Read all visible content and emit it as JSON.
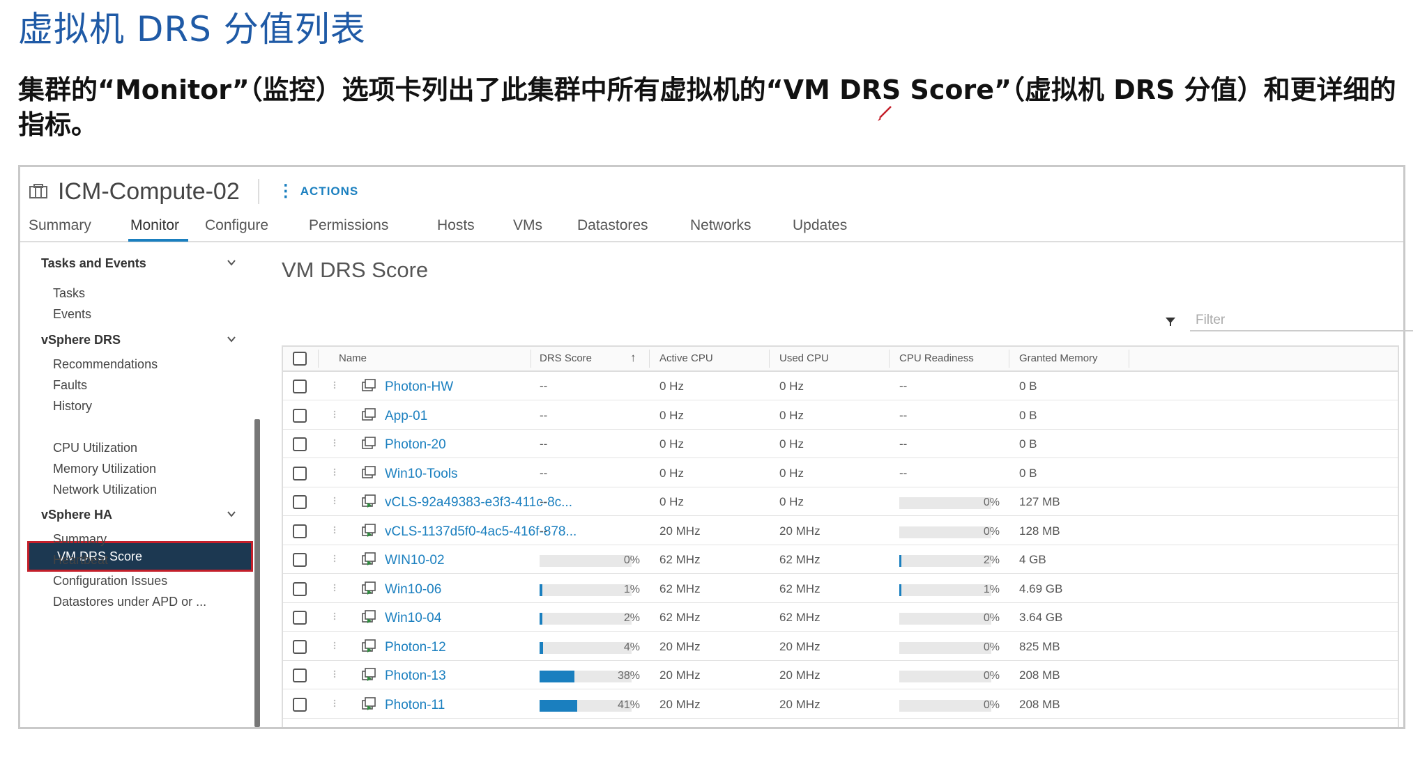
{
  "slide": {
    "title": "虚拟机 DRS 分值列表",
    "description": "集群的“Monitor”（监控）选项卡列出了此集群中所有虚拟机的“VM DRS Score”（虚拟机 DRS 分值）和更详细的指标。"
  },
  "header": {
    "object_name": "ICM-Compute-02",
    "actions_label": "ACTIONS",
    "icon": "cluster-icon"
  },
  "tabs": [
    {
      "label": "Summary"
    },
    {
      "label": "Monitor",
      "active": true
    },
    {
      "label": "Configure"
    },
    {
      "label": "Permissions"
    },
    {
      "label": "Hosts"
    },
    {
      "label": "VMs"
    },
    {
      "label": "Datastores"
    },
    {
      "label": "Networks"
    },
    {
      "label": "Updates"
    }
  ],
  "sidebar": {
    "sections": [
      {
        "label": "Tasks and Events",
        "items": [
          "Tasks",
          "Events"
        ]
      },
      {
        "label": "vSphere DRS",
        "items": [
          "Recommendations",
          "Faults",
          "History",
          "VM DRS Score",
          "CPU Utilization",
          "Memory Utilization",
          "Network Utilization"
        ]
      },
      {
        "label": "vSphere HA",
        "items": [
          "Summary",
          "Heartbeat",
          "Configuration Issues",
          "Datastores under APD or ..."
        ]
      }
    ],
    "selected_item": "VM DRS Score"
  },
  "main": {
    "title": "VM DRS Score",
    "filter_placeholder": "Filter",
    "columns": [
      "Name",
      "DRS Score",
      "Active CPU",
      "Used CPU",
      "CPU Readiness",
      "Granted Memory"
    ],
    "sort_indicator": "↑",
    "rows": [
      {
        "name": "Photon-HW",
        "icon": "vm-icon",
        "drs_score": "--",
        "drs_pct": null,
        "active_cpu": "0 Hz",
        "used_cpu": "0 Hz",
        "cpu_readiness": "--",
        "ready_pct": null,
        "granted_memory": "0 B"
      },
      {
        "name": "App-01",
        "icon": "vm-icon",
        "drs_score": "--",
        "drs_pct": null,
        "active_cpu": "0 Hz",
        "used_cpu": "0 Hz",
        "cpu_readiness": "--",
        "ready_pct": null,
        "granted_memory": "0 B"
      },
      {
        "name": "Photon-20",
        "icon": "vm-icon",
        "drs_score": "--",
        "drs_pct": null,
        "active_cpu": "0 Hz",
        "used_cpu": "0 Hz",
        "cpu_readiness": "--",
        "ready_pct": null,
        "granted_memory": "0 B"
      },
      {
        "name": "Win10-Tools",
        "icon": "vm-icon",
        "drs_score": "--",
        "drs_pct": null,
        "active_cpu": "0 Hz",
        "used_cpu": "0 Hz",
        "cpu_readiness": "--",
        "ready_pct": null,
        "granted_memory": "0 B"
      },
      {
        "name": "vCLS-92a49383-e3f3-411c-8c...",
        "icon": "vm-running-icon",
        "drs_score": "--",
        "drs_pct": null,
        "active_cpu": "0 Hz",
        "used_cpu": "0 Hz",
        "cpu_readiness": "0%",
        "ready_pct": 0,
        "granted_memory": "127 MB"
      },
      {
        "name": "vCLS-1137d5f0-4ac5-416f-878...",
        "icon": "vm-running-icon",
        "drs_score": "--",
        "drs_pct": null,
        "active_cpu": "20 MHz",
        "used_cpu": "20 MHz",
        "cpu_readiness": "0%",
        "ready_pct": 0,
        "granted_memory": "128 MB"
      },
      {
        "name": "WIN10-02",
        "icon": "vm-running-icon",
        "drs_score": "0%",
        "drs_pct": 0,
        "active_cpu": "62 MHz",
        "used_cpu": "62 MHz",
        "cpu_readiness": "2%",
        "ready_pct": 2,
        "granted_memory": "4 GB"
      },
      {
        "name": "Win10-06",
        "icon": "vm-running-icon",
        "drs_score": "1%",
        "drs_pct": 1,
        "active_cpu": "62 MHz",
        "used_cpu": "62 MHz",
        "cpu_readiness": "1%",
        "ready_pct": 1,
        "granted_memory": "4.69 GB"
      },
      {
        "name": "Win10-04",
        "icon": "vm-running-icon",
        "drs_score": "2%",
        "drs_pct": 2,
        "active_cpu": "62 MHz",
        "used_cpu": "62 MHz",
        "cpu_readiness": "0%",
        "ready_pct": 0,
        "granted_memory": "3.64 GB"
      },
      {
        "name": "Photon-12",
        "icon": "vm-running-icon",
        "drs_score": "4%",
        "drs_pct": 4,
        "active_cpu": "20 MHz",
        "used_cpu": "20 MHz",
        "cpu_readiness": "0%",
        "ready_pct": 0,
        "granted_memory": "825 MB"
      },
      {
        "name": "Photon-13",
        "icon": "vm-running-icon",
        "drs_score": "38%",
        "drs_pct": 38,
        "active_cpu": "20 MHz",
        "used_cpu": "20 MHz",
        "cpu_readiness": "0%",
        "ready_pct": 0,
        "granted_memory": "208 MB"
      },
      {
        "name": "Photon-11",
        "icon": "vm-running-icon",
        "drs_score": "41%",
        "drs_pct": 41,
        "active_cpu": "20 MHz",
        "used_cpu": "20 MHz",
        "cpu_readiness": "0%",
        "ready_pct": 0,
        "granted_memory": "208 MB"
      }
    ]
  },
  "colors": {
    "accent": "#1a7fbf",
    "selected_bg": "#1c3851",
    "highlight_border": "#c41f2a",
    "title_blue": "#1f5aa6"
  }
}
